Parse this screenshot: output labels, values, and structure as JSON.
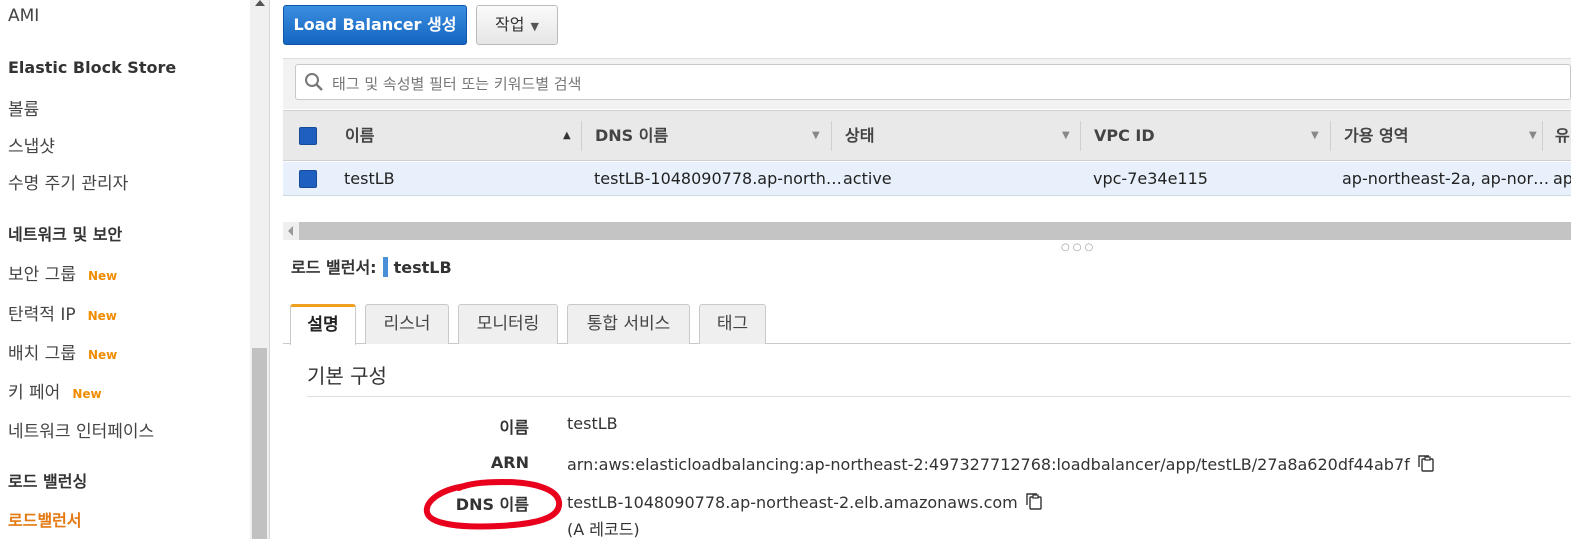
{
  "sidebar": {
    "items": [
      {
        "label": "AMI",
        "type": "item"
      },
      {
        "label": "Elastic Block Store",
        "type": "head"
      },
      {
        "label": "볼륨",
        "type": "item"
      },
      {
        "label": "스냅샷",
        "type": "item"
      },
      {
        "label": "수명 주기 관리자",
        "type": "item"
      },
      {
        "label": "네트워크 및 보안",
        "type": "head"
      },
      {
        "label": "보안 그룹",
        "type": "item",
        "badge": "New"
      },
      {
        "label": "탄력적 IP",
        "type": "item",
        "badge": "New"
      },
      {
        "label": "배치 그룹",
        "type": "item",
        "badge": "New"
      },
      {
        "label": "키 페어",
        "type": "item",
        "badge": "New"
      },
      {
        "label": "네트워크 인터페이스",
        "type": "item"
      },
      {
        "label": "로드 밸런싱",
        "type": "head"
      },
      {
        "label": "로드밸런서",
        "type": "active"
      }
    ]
  },
  "toolbar": {
    "create_label": "Load Balancer 생성",
    "actions_label": "작업"
  },
  "search": {
    "placeholder": "태그 및 속성별 필터 또는 키워드별 검색"
  },
  "table": {
    "columns": [
      "이름",
      "DNS 이름",
      "상태",
      "VPC ID",
      "가용 영역",
      "유"
    ],
    "rows": [
      {
        "name": "testLB",
        "dns": "testLB-1048090778.ap-north…",
        "state": "active",
        "vpc": "vpc-7e34e115",
        "az": "ap-northeast-2a, ap-nor…",
        "extra": "ap"
      }
    ]
  },
  "detail": {
    "title_prefix": "로드 밸런서:",
    "title_name": "testLB",
    "tabs": [
      "설명",
      "리스너",
      "모니터링",
      "통합 서비스",
      "태그"
    ],
    "section_title": "기본 구성",
    "fields": [
      {
        "label": "이름",
        "value": "testLB"
      },
      {
        "label": "ARN",
        "value": "arn:aws:elasticloadbalancing:ap-northeast-2:497327712768:loadbalancer/app/testLB/27a8a620df44ab7f"
      },
      {
        "label": "DNS 이름",
        "value": "testLB-1048090778.ap-northeast-2.elb.amazonaws.com",
        "note": "(A 레코드)"
      }
    ]
  },
  "colors": {
    "primary": "#1565c0",
    "active_nav": "#e47911",
    "badge": "#f08c00",
    "annotation": "#e8001c"
  }
}
